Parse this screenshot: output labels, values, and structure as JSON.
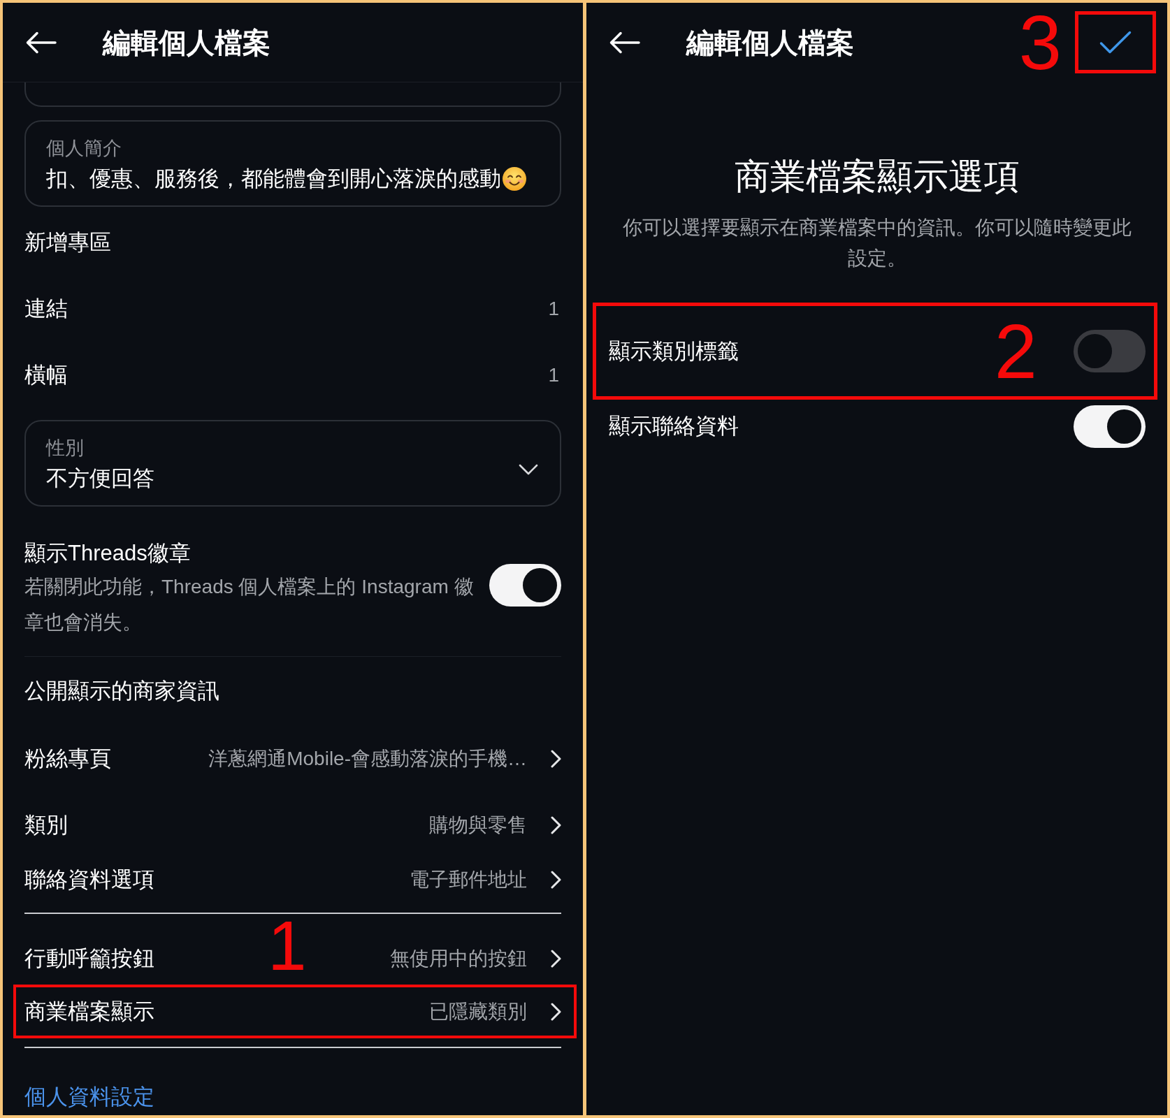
{
  "left_screen": {
    "header": {
      "title": "編輯個人檔案"
    },
    "bio_field": {
      "label": "個人簡介",
      "value": "扣、優惠、服務後，都能體會到開心落淚的感動"
    },
    "items": [
      {
        "kind": "link",
        "label": "新增專區"
      },
      {
        "kind": "count",
        "label": "連結",
        "count": "1"
      },
      {
        "kind": "count",
        "label": "橫幅",
        "count": "1"
      }
    ],
    "gender_field": {
      "label": "性別",
      "value": "不方便回答"
    },
    "threads_badge": {
      "title": "顯示Threads徽章",
      "description": "若關閉此功能，Threads 個人檔案上的 Instagram 徽章也會消失。",
      "on": true
    },
    "business_info": {
      "heading": "公開顯示的商家資訊",
      "groups": [
        {
          "rows": [
            {
              "label": "粉絲專頁",
              "value": "洋蔥網通Mobile-會感動落淚的手機…",
              "highlighted": false
            },
            {
              "label": "類別",
              "value": "購物與零售",
              "highlighted": false
            },
            {
              "label": "聯絡資料選項",
              "value": "電子郵件地址",
              "highlighted": false
            }
          ]
        },
        {
          "rows": [
            {
              "label": "行動呼籲按鈕",
              "value": "無使用中的按鈕",
              "highlighted": false
            },
            {
              "label": "商業檔案顯示",
              "value": "已隱藏類別",
              "highlighted": true,
              "annotation": "1"
            }
          ]
        }
      ]
    },
    "footer_link": "個人資料設定"
  },
  "right_screen": {
    "header": {
      "title": "編輯個人檔案",
      "confirm": {
        "highlighted": true,
        "annotation": "3"
      }
    },
    "heading": "商業檔案顯示選項",
    "description": "你可以選擇要顯示在商業檔案中的資訊。你可以隨時變更此設定。",
    "toggles": [
      {
        "label": "顯示類別標籤",
        "on": false,
        "highlighted": true,
        "annotation": "2"
      },
      {
        "label": "顯示聯絡資料",
        "on": true,
        "highlighted": false
      }
    ]
  }
}
